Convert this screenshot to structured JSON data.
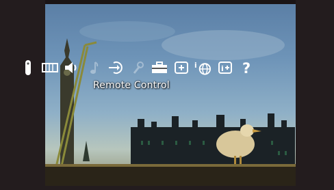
{
  "menu": {
    "items": [
      {
        "icon": "remote-icon",
        "state": "selected"
      },
      {
        "icon": "video-icon",
        "state": "normal"
      },
      {
        "icon": "speaker-icon",
        "state": "normal"
      },
      {
        "icon": "music-note-icon",
        "state": "disabled"
      },
      {
        "icon": "input-icon",
        "state": "normal"
      },
      {
        "icon": "wrench-icon",
        "state": "disabled"
      },
      {
        "icon": "toolbox-icon",
        "state": "normal"
      },
      {
        "icon": "add-screen-icon",
        "state": "normal"
      },
      {
        "icon": "info-globe-icon",
        "state": "normal"
      },
      {
        "icon": "info-plus-icon",
        "state": "normal"
      },
      {
        "icon": "help-icon",
        "state": "normal"
      }
    ],
    "selected_label": "Remote Control"
  },
  "colors": {
    "frame": "#231c1e",
    "icon": "#ffffff",
    "sky": "#6e94b8"
  }
}
